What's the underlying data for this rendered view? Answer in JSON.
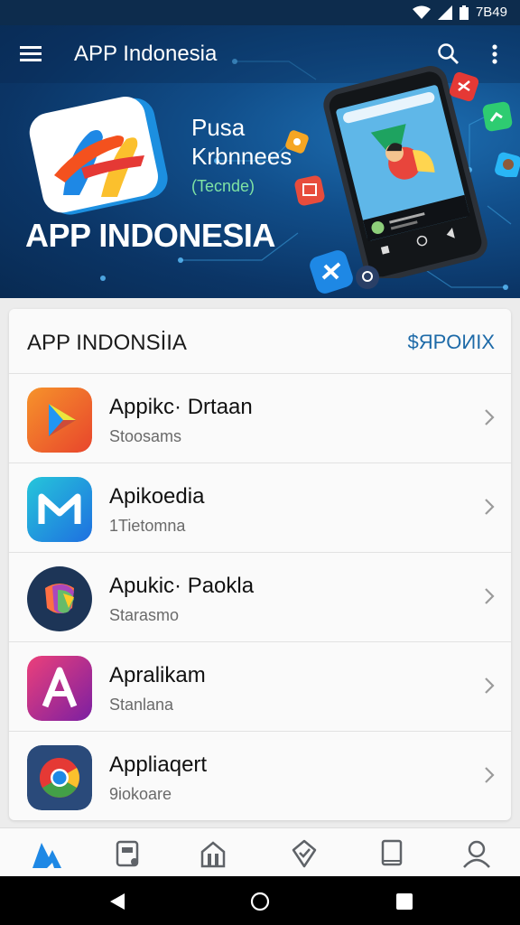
{
  "status_bar": {
    "time": "7B49",
    "icons": [
      "wifi-icon",
      "signal-icon",
      "battery-icon"
    ]
  },
  "app_bar": {
    "title": "APP Indonesia",
    "icons": [
      "menu-icon",
      "search-icon",
      "more-vert-icon"
    ]
  },
  "hero": {
    "line1": "Pusa",
    "line2": "Krbnnees",
    "line3": "(Tecnde)",
    "headline": "APP INDONESIA"
  },
  "card": {
    "title": "APP INDONSİIA",
    "link": "$ЯPOИIX",
    "items": [
      {
        "title": "Appikc· Drtaan",
        "subtitle": "Stoosams",
        "icon": "play-store-icon"
      },
      {
        "title": "Apikoedia",
        "subtitle": "1Tietomna",
        "icon": "m-app-icon"
      },
      {
        "title": "Apukic· Paokla",
        "subtitle": "Starasmo",
        "icon": "colorful-shield-icon"
      },
      {
        "title": "Apralikam",
        "subtitle": "Stanlana",
        "icon": "a-app-icon"
      },
      {
        "title": "Appliaqert",
        "subtitle": "9iokoare",
        "icon": "chrome-icon"
      }
    ]
  },
  "bottom_nav": [
    "home-logo-icon",
    "apps-icon",
    "store-icon",
    "badge-icon",
    "book-icon",
    "account-icon"
  ],
  "system_nav": [
    "back-icon",
    "home-icon",
    "recents-icon"
  ],
  "colors": {
    "accent": "#1d6aa8",
    "hero_dark": "#0b3566",
    "status": "#0d2c4d"
  }
}
